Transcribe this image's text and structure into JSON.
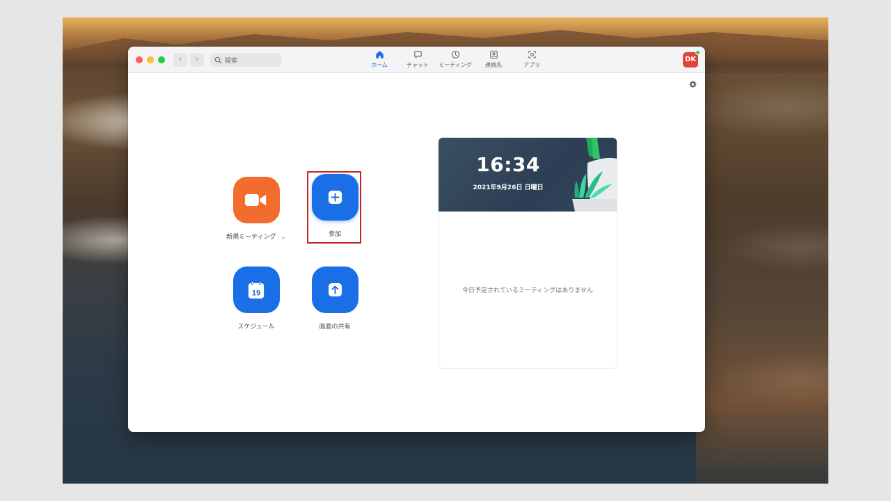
{
  "toolbar": {
    "search_placeholder": "検索",
    "tabs": [
      {
        "label": "ホーム",
        "icon": "home-icon",
        "active": true
      },
      {
        "label": "チャット",
        "icon": "chat-icon",
        "active": false
      },
      {
        "label": "ミーティング",
        "icon": "clock-icon",
        "active": false
      },
      {
        "label": "連絡先",
        "icon": "contacts-icon",
        "active": false
      },
      {
        "label": "アプリ",
        "icon": "apps-icon",
        "active": false
      }
    ],
    "avatar_initials": "DK"
  },
  "actions": {
    "new_meeting": {
      "label": "新規ミーティング",
      "icon": "video-camera-icon",
      "dropdown": "⌄"
    },
    "join": {
      "label": "参加",
      "icon": "plus-icon"
    },
    "schedule": {
      "label": "スケジュール",
      "icon": "calendar-icon",
      "calendar_day": "19"
    },
    "share_screen": {
      "label": "画面の共有",
      "icon": "share-arrow-icon"
    }
  },
  "card": {
    "time": "16:34",
    "date": "2021年9月26日 日曜日",
    "empty_message": "今日予定されているミーティングはありません"
  },
  "colors": {
    "accent_blue": "#1a6ee6",
    "orange": "#f26d2d",
    "highlight_red": "#c62222",
    "avatar_red": "#e0443a",
    "status_green": "#2fcc5c"
  }
}
